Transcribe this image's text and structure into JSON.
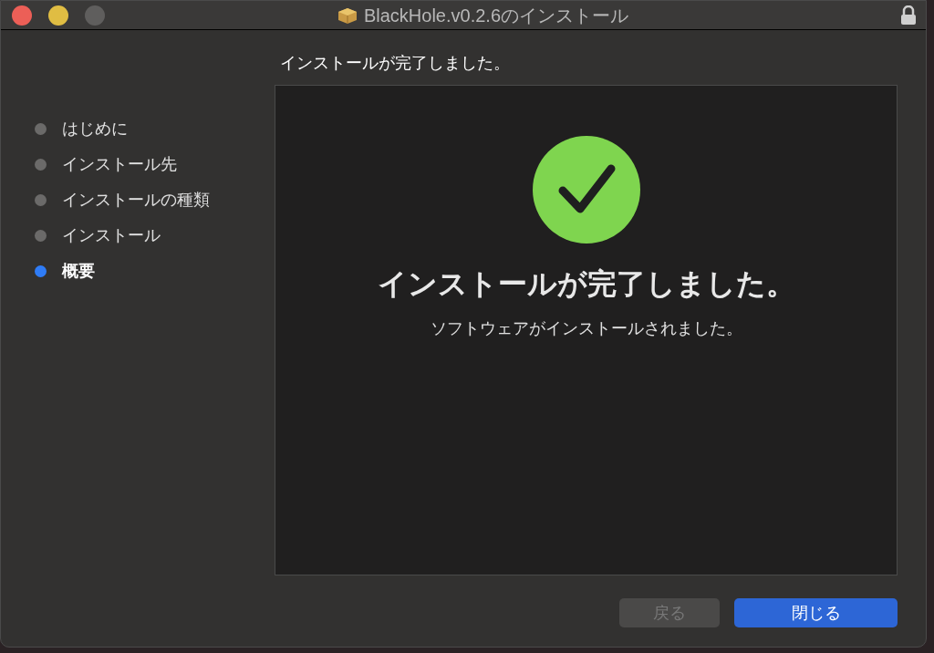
{
  "window": {
    "title": "BlackHole.v0.2.6のインストール"
  },
  "steps": [
    {
      "label": "はじめに",
      "selected": false
    },
    {
      "label": "インストール先",
      "selected": false
    },
    {
      "label": "インストールの種類",
      "selected": false
    },
    {
      "label": "インストール",
      "selected": false
    },
    {
      "label": "概要",
      "selected": true
    }
  ],
  "heading": "インストールが完了しました。",
  "panel": {
    "title": "インストールが完了しました。",
    "message": "ソフトウェアがインストールされました。"
  },
  "buttons": [
    {
      "label": "戻る",
      "disabled": true,
      "default": false
    },
    {
      "label": "閉じる",
      "disabled": false,
      "default": true
    }
  ]
}
